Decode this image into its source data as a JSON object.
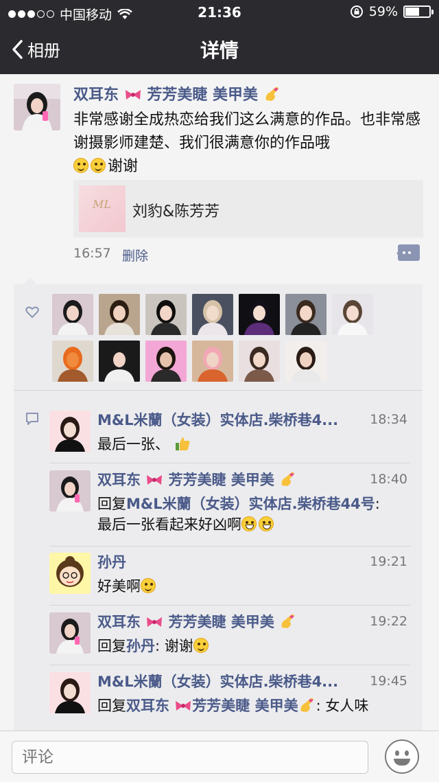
{
  "status_bar": {
    "carrier": "中国移动",
    "time": "21:36",
    "battery": "59%",
    "battery_level": 0.59
  },
  "nav": {
    "back_label": "相册",
    "title": "详情"
  },
  "post": {
    "author": "双耳东",
    "author_suffix": "芳芳美睫 美甲美",
    "text_line1": "非常感谢全成热恋给我们这么满意的作品。也非常感谢摄影师建楚、我们很满意你的作品哦",
    "text_tail": "谢谢",
    "link_title": "刘豹&陈芳芳",
    "time": "16:57",
    "delete_label": "删除"
  },
  "likes_count": 14,
  "comments": [
    {
      "name": "M&L米蘭（女装）实体店.柴桥巷4...",
      "time": "18:34",
      "text": "最后一张、"
    },
    {
      "name": "双耳东",
      "name_suffix": "芳芳美睫 美甲美",
      "time": "18:40",
      "reply_prefix": "回复",
      "reply_to": "M&L米蘭（女装）实体店.柴桥巷44号",
      "text": "最后一张看起来好凶啊"
    },
    {
      "name": "孙丹",
      "time": "19:21",
      "text": "好美啊"
    },
    {
      "name": "双耳东",
      "name_suffix": "芳芳美睫 美甲美",
      "time": "19:22",
      "reply_prefix": "回复",
      "reply_to": "孙丹",
      "text": "谢谢"
    },
    {
      "name": "M&L米蘭（女装）实体店.柴桥巷4...",
      "time": "19:45",
      "reply_prefix": "回复",
      "reply_to": "双耳东",
      "reply_to_suffix": "芳芳美睫 美甲美",
      "text": "女人味"
    }
  ],
  "input": {
    "placeholder": "评论"
  },
  "colors": {
    "header_bg": "#2b2b2f",
    "link_blue": "#4a5a89",
    "panel_bg": "#ececee"
  }
}
